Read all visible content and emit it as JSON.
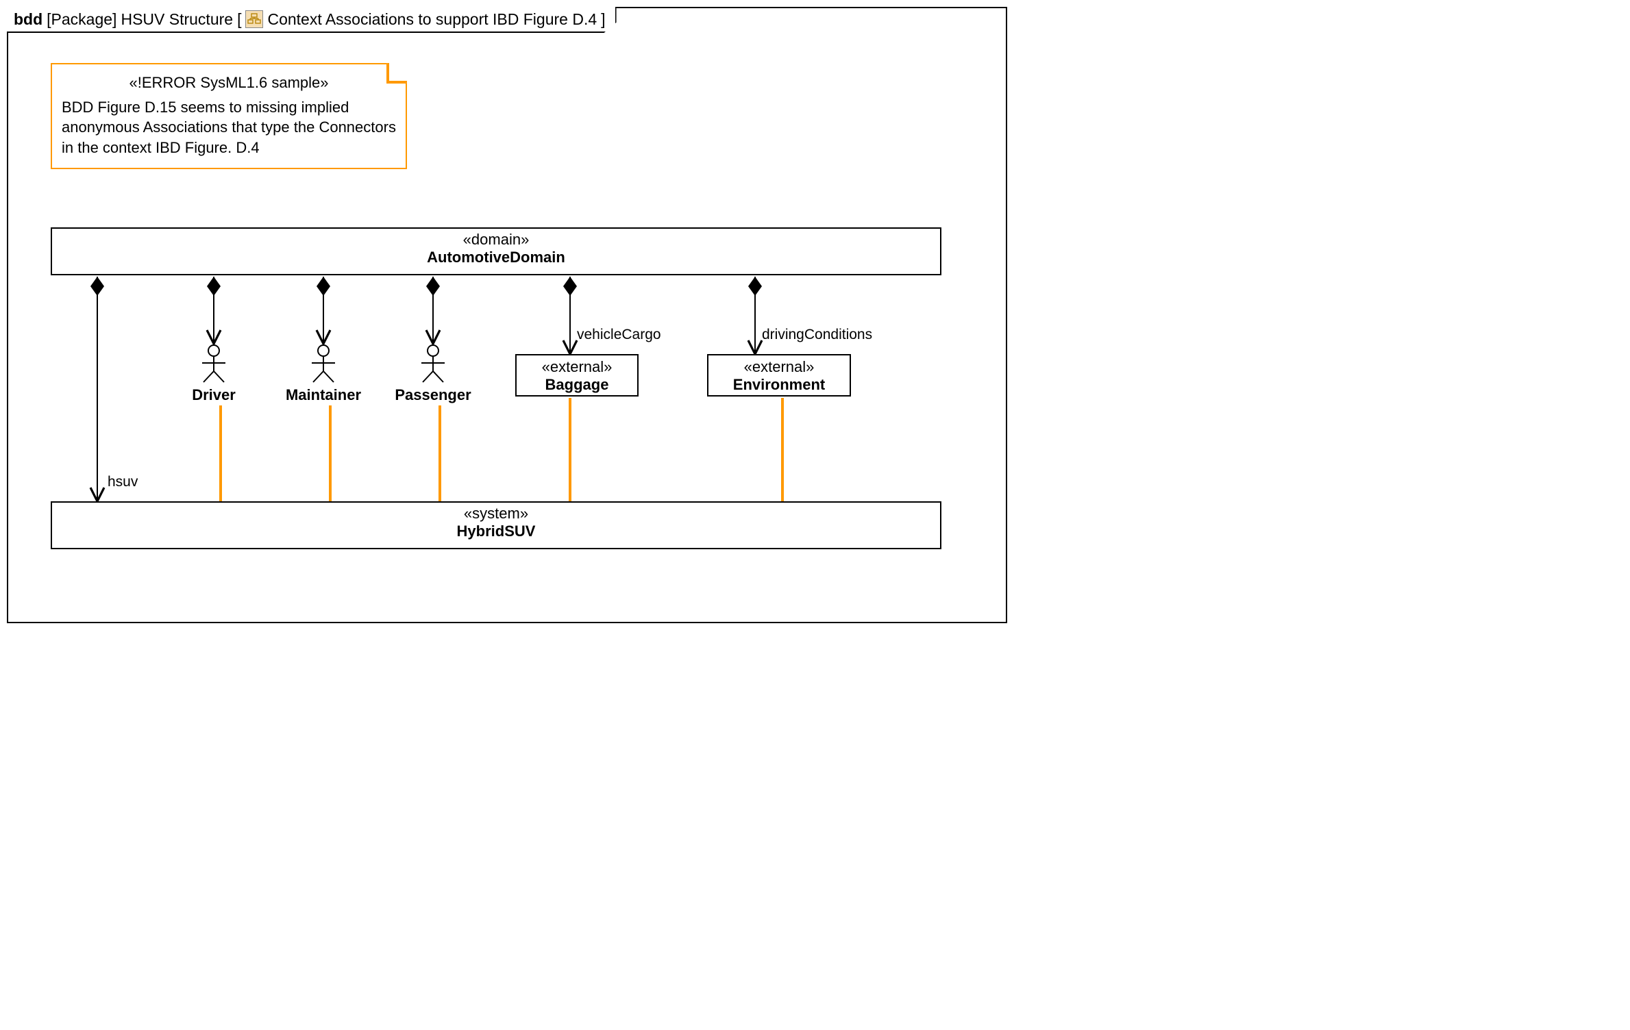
{
  "header": {
    "kind": "bdd",
    "pkg_label": "[Package]",
    "pkg_name": "HSUV Structure",
    "bracket_open": "[",
    "title": "Context Associations to support IBD Figure D.4",
    "bracket_close": "]"
  },
  "note": {
    "stereotype": "«!ERROR SysML1.6 sample»",
    "body": "BDD Figure D.15 seems to missing implied anonymous Associations that type the Connectors in the context IBD Figure. D.4"
  },
  "blocks": {
    "domain": {
      "stereo": "«domain»",
      "name": "AutomotiveDomain"
    },
    "system": {
      "stereo": "«system»",
      "name": "HybridSUV"
    },
    "baggage": {
      "stereo": "«external»",
      "name": "Baggage"
    },
    "environment": {
      "stereo": "«external»",
      "name": "Environment"
    }
  },
  "actors": {
    "driver": "Driver",
    "maintainer": "Maintainer",
    "passenger": "Passenger"
  },
  "labels": {
    "hsuv": "hsuv",
    "vehicleCargo": "vehicleCargo",
    "drivingConditions": "drivingConditions"
  }
}
